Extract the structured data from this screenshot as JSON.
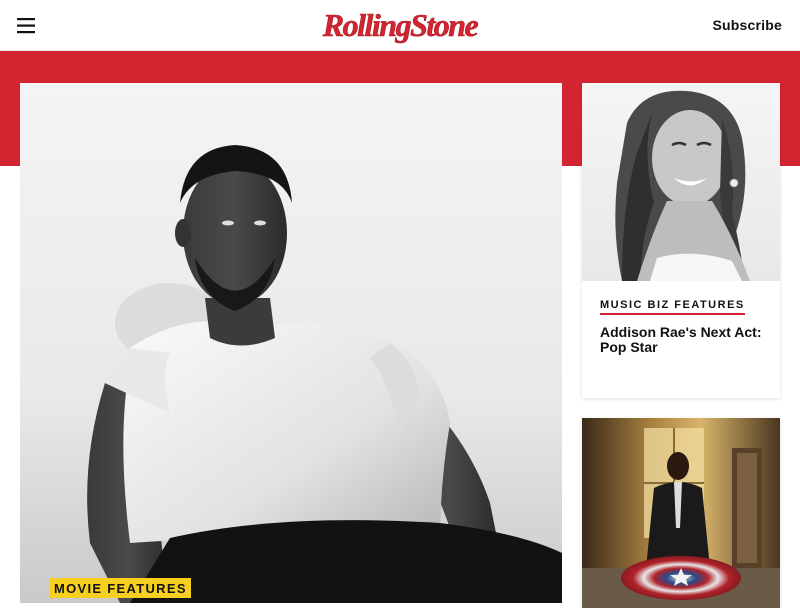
{
  "header": {
    "logo_text": "RollingStone",
    "subscribe_label": "Subscribe"
  },
  "lead_story": {
    "category": "MOVIE FEATURES"
  },
  "side_stories": [
    {
      "category": "MUSIC BIZ FEATURES",
      "title": "Addison Rae's Next Act: Pop Star"
    },
    {
      "category": "",
      "title": ""
    }
  ],
  "colors": {
    "brand_red": "#d32531",
    "tag_yellow": "#f7cf20",
    "text_dark": "#111111"
  },
  "icons": {
    "menu": "hamburger-menu-icon"
  }
}
